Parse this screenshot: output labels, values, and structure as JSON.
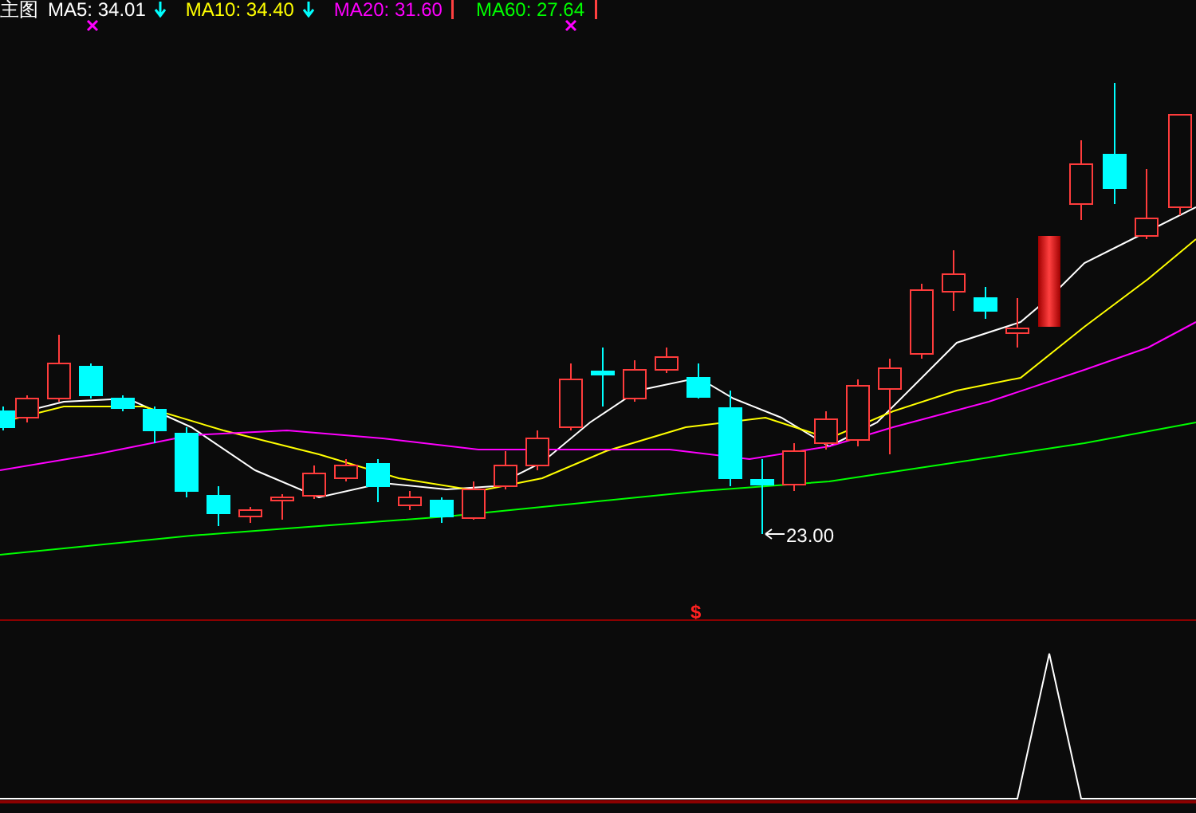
{
  "legend": [
    {
      "label": "主图",
      "color": "#ffffff"
    },
    {
      "label": "MA5: 34.01",
      "color": "#ffffff"
    },
    {
      "label": "MA10: 34.40",
      "color": "#ffff00"
    },
    {
      "label": "MA20: 31.60",
      "color": "#ff00ff"
    },
    {
      "label": "MA60: 27.64",
      "color": "#00ff00"
    }
  ],
  "low_price_label": "23.00",
  "signal_marker": "$"
}
